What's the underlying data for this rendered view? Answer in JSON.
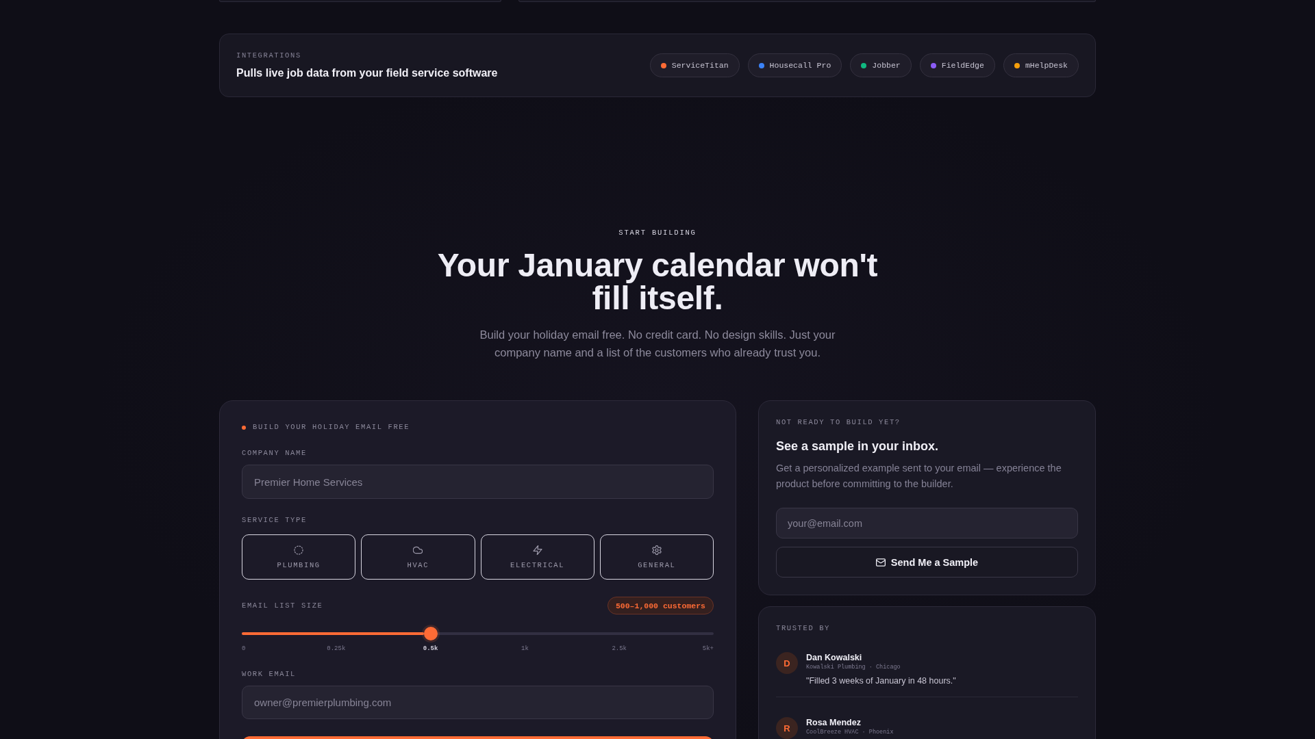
{
  "integrations": {
    "label": "INTEGRATIONS",
    "title": "Pulls live job data from your field service software",
    "tools": [
      {
        "name": "ServiceTitan",
        "color": "#ff6b35"
      },
      {
        "name": "Housecall Pro",
        "color": "#3b82f6"
      },
      {
        "name": "Jobber",
        "color": "#10b981"
      },
      {
        "name": "FieldEdge",
        "color": "#8b5cf6"
      },
      {
        "name": "mHelpDesk",
        "color": "#f59e0b"
      }
    ]
  },
  "hero": {
    "eyebrow": "START BUILDING",
    "heading": "Your January calendar won't fill itself.",
    "subtitle": "Build your holiday email free. No credit card. No design skills. Just your company name and a list of the customers who already trust you."
  },
  "builder": {
    "badge": "BUILD YOUR HOLIDAY EMAIL FREE",
    "company_name": {
      "label": "COMPANY NAME",
      "placeholder": "Premier Home Services"
    },
    "service_type": {
      "label": "SERVICE TYPE",
      "options": [
        {
          "label": "PLUMBING"
        },
        {
          "label": "HVAC"
        },
        {
          "label": "ELECTRICAL"
        },
        {
          "label": "GENERAL"
        }
      ]
    },
    "list_size": {
      "label": "EMAIL LIST SIZE",
      "reading": "500–1,000 customers",
      "level": 0.4,
      "ticks": [
        {
          "label": "0",
          "selected": false
        },
        {
          "label": "0.25k",
          "selected": false
        },
        {
          "label": "0.5k",
          "selected": true
        },
        {
          "label": "1k",
          "selected": false
        },
        {
          "label": "2.5k",
          "selected": false
        },
        {
          "label": "5k+",
          "selected": false
        }
      ]
    },
    "work_email": {
      "label": "WORK EMAIL",
      "placeholder": "owner@premierplumbing.com"
    }
  },
  "sample": {
    "eyebrow": "NOT READY TO BUILD YET?",
    "title": "See a sample in your inbox.",
    "description": "Get a personalized example sent to your email — experience the product before committing to the builder.",
    "email": {
      "placeholder": "your@email.com"
    },
    "button": "Send Me a Sample"
  },
  "trusted": {
    "label": "TRUSTED BY",
    "testimonials": [
      {
        "initial": "D",
        "name": "Dan Kowalski",
        "company": "Kowalski Plumbing · Chicago",
        "quote": "\"Filled 3 weeks of January in 48 hours.\""
      },
      {
        "initial": "R",
        "name": "Rosa Mendez",
        "company": "CoolBreeze HVAC · Phoenix"
      }
    ]
  }
}
